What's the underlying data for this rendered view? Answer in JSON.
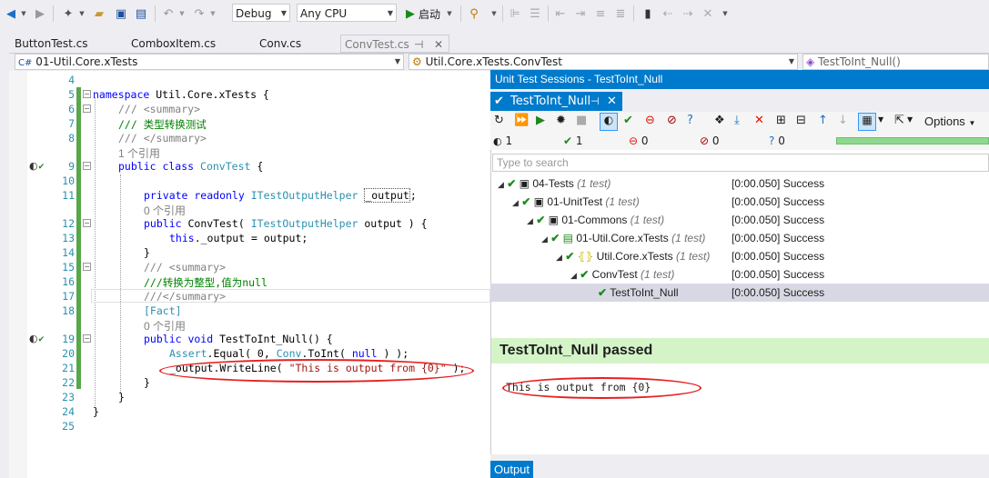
{
  "toolbar": {
    "config_value": "Debug",
    "platform_value": "Any CPU",
    "start_label": "启动"
  },
  "tabs": [
    "ButtonTest.cs",
    "ComboxItem.cs",
    "Conv.cs",
    "ConvTest.cs"
  ],
  "navbar": {
    "project": "01-Util.Core.xTests",
    "type": "Util.Core.xTests.ConvTest",
    "member": "TestToInt_Null()"
  },
  "code": {
    "line_numbers": [
      "4",
      "5",
      "6",
      "7",
      "8",
      "9",
      "10",
      "11",
      "12",
      "13",
      "14",
      "15",
      "16",
      "17",
      "18",
      "19",
      "20",
      "21",
      "22",
      "23",
      "24",
      "25"
    ],
    "l5_kw": "namespace",
    "l5_rest": " Util.Core.xTests {",
    "l6": "/// <summary>",
    "l7": "/// 类型转换测试",
    "l8": "/// </summary>",
    "ref1": "1 个引用",
    "l9_kw": "public class",
    "l9_type": "ConvTest",
    "l9_rest": " {",
    "l11_kw": "private readonly",
    "l11_type": "ITestOutputHelper",
    "l11_rest": "_output",
    "ref2": "0 个引用",
    "l12_kw": "public",
    "l12_name": " ConvTest( ",
    "l12_type": "ITestOutputHelper",
    "l12_rest": " output ) {",
    "l13_kw": "this",
    "l13_rest": "._output = output;",
    "l14": "}",
    "l15": "/// <summary>",
    "l16": "///转换为整型,值为null",
    "l17": "///</summary>",
    "l18": "[Fact]",
    "ref3": "0 个引用",
    "l19_kw": "public void",
    "l19_rest": " TestToInt_Null() {",
    "l20_type": "Assert",
    "l20_a": ".Equal( 0, ",
    "l20_type2": "Conv",
    "l20_b": ".ToInt( ",
    "l20_kw": "null",
    "l20_c": " ) );",
    "l21_a": "_output.WriteLine( ",
    "l21_str": "\"This is output from {0}\"",
    "l21_b": " );",
    "l22": "}",
    "l23": "}",
    "l24": "}"
  },
  "test_window": {
    "title": "Unit Test Sessions - TestToInt_Null",
    "tab_label": "TestToInt_Null",
    "options_label": "Options",
    "stats": {
      "total": "1",
      "passed": "1",
      "failed": "0",
      "ignored": "0",
      "unknown": "0"
    },
    "search_placeholder": "Type to search",
    "tree": [
      {
        "name": "04-Tests",
        "count": "(1 test)",
        "result": "[0:00.050] Success"
      },
      {
        "name": "01-UnitTest",
        "count": "(1 test)",
        "result": "[0:00.050] Success"
      },
      {
        "name": "01-Commons",
        "count": "(1 test)",
        "result": "[0:00.050] Success"
      },
      {
        "name": "01-Util.Core.xTests",
        "count": "(1 test)",
        "result": "[0:00.050] Success"
      },
      {
        "name": "Util.Core.xTests",
        "count": "(1 test)",
        "result": "[0:00.050] Success"
      },
      {
        "name": "ConvTest",
        "count": "(1 test)",
        "result": "[0:00.050] Success"
      },
      {
        "name": "TestToInt_Null",
        "count": "",
        "result": "[0:00.050] Success"
      }
    ],
    "passed_header": "TestToInt_Null passed",
    "output_text": "This is output from {0}",
    "output_tab": "Output"
  }
}
